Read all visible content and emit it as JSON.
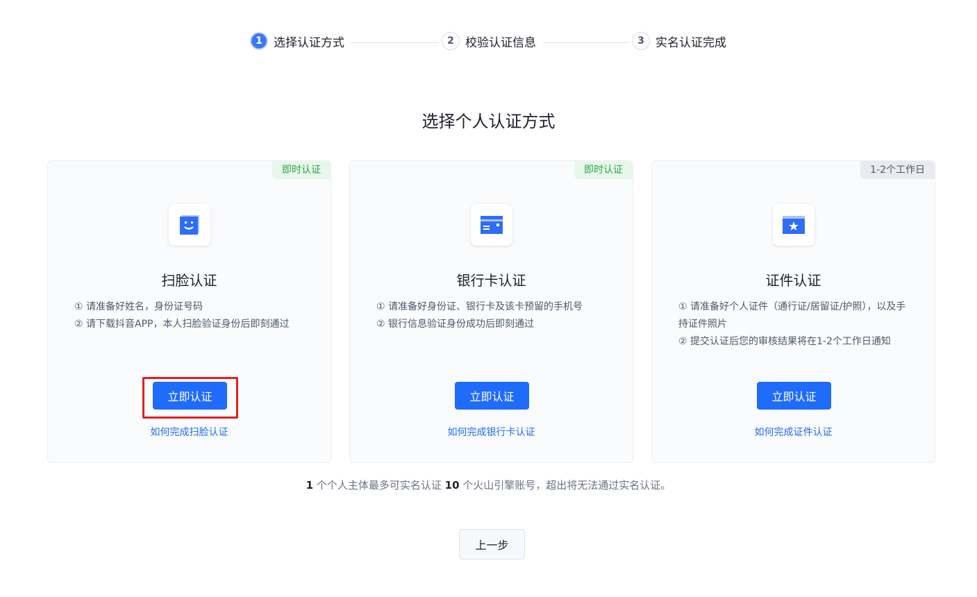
{
  "stepper": {
    "steps": [
      {
        "num": "1",
        "label": "选择认证方式"
      },
      {
        "num": "2",
        "label": "校验认证信息"
      },
      {
        "num": "3",
        "label": "实名认证完成"
      }
    ]
  },
  "page_title": "选择个人认证方式",
  "cards": [
    {
      "tag": "即时认证",
      "icon": "face-scan-icon",
      "title": "扫脸认证",
      "desc": [
        "① 请准备好姓名，身份证号码",
        "② 请下载抖音APP，本人扫脸验证身份后即刻通过"
      ],
      "button": "立即认证",
      "link": "如何完成扫脸认证"
    },
    {
      "tag": "即时认证",
      "icon": "bank-card-icon",
      "title": "银行卡认证",
      "desc": [
        "① 请准备好身份证、银行卡及该卡预留的手机号",
        "② 银行信息验证身份成功后即刻通过"
      ],
      "button": "立即认证",
      "link": "如何完成银行卡认证"
    },
    {
      "tag": "1-2个工作日",
      "icon": "id-document-icon",
      "title": "证件认证",
      "desc": [
        "① 请准备好个人证件（通行证/居留证/护照），以及手持证件照片",
        "② 提交认证后您的审核结果将在1-2个工作日通知"
      ],
      "button": "立即认证",
      "link": "如何完成证件认证"
    }
  ],
  "footnote": {
    "count1": "1",
    "text1": " 个个人主体最多可实名认证 ",
    "count2": "10",
    "text2": " 个火山引擎账号，超出将无法通过实名认证。"
  },
  "back_button": "上一步",
  "colors": {
    "primary": "#1f6bfa",
    "highlight": "#e02020",
    "tag_green": "#2ba346"
  }
}
